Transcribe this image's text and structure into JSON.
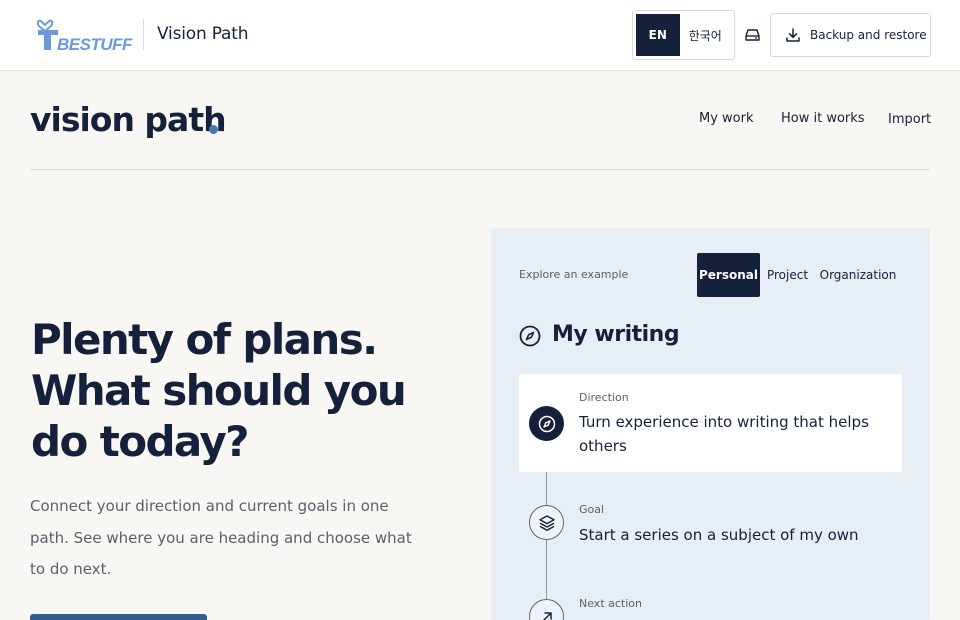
{
  "topbar": {
    "logo_text": "BESTUFF",
    "app_title": "Vision Path",
    "lang_en": "EN",
    "lang_ko": "한국어",
    "backup_label": "Backup and restore",
    "icons": [
      "logo-mark",
      "drive-icon",
      "download-icon"
    ]
  },
  "header": {
    "brand": "vision path",
    "nav": {
      "my_work": "My work",
      "how_it_works": "How it works",
      "import": "Import"
    }
  },
  "hero": {
    "title": "Plenty of plans. What should you do today?",
    "description": "Connect your direction and current goals in one path. See where you are heading and choose what to do next."
  },
  "example": {
    "explore_label": "Explore an example",
    "tabs": [
      "Personal",
      "Project",
      "Organization"
    ],
    "active_tab": "Personal",
    "section_title": "My writing",
    "steps": [
      {
        "label": "Direction",
        "text": "Turn experience into writing that helps others",
        "icon": "compass-icon"
      },
      {
        "label": "Goal",
        "text": "Start a series on a subject of my own",
        "icon": "layers-icon"
      },
      {
        "label": "Next action",
        "text": "",
        "icon": "arrow-up-right-icon"
      }
    ]
  },
  "colors": {
    "navy": "#15213a",
    "accent_blue": "#2e5f8e",
    "panel_bg": "#e7eef6",
    "page_bg": "#f9f7f4",
    "logo_blue": "#6b9bd8"
  }
}
